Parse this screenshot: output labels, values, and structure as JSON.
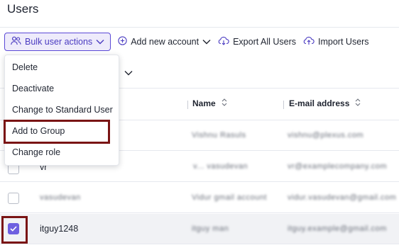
{
  "header": {
    "title": "Users"
  },
  "toolbar": {
    "bulk_label": "Bulk user actions",
    "add_label": "Add new account",
    "export_label": "Export All Users",
    "import_label": "Import Users"
  },
  "bulk_menu": {
    "items": [
      "Delete",
      "Deactivate",
      "Change to Standard User",
      "Add to Group",
      "Change role"
    ]
  },
  "table": {
    "columns": [
      "Name",
      "E-mail address"
    ],
    "rows": [
      {
        "username": "",
        "name": "Vishnu Rasuls",
        "email": "vishnu@plexus.com",
        "checked": false
      },
      {
        "username": "vr",
        "name": "v... vasudevan",
        "email": "vr@examplecompany.com",
        "checked": false
      },
      {
        "username": "vasudevan",
        "name": "Vidur gmail account",
        "email": "vidur.vasudevan@gmail.com",
        "checked": false
      },
      {
        "username": "itguy1248",
        "name": "itguy man",
        "email": "itguy.example@gmail.com",
        "checked": true
      }
    ]
  },
  "colors": {
    "accent": "#5b49d6",
    "highlight": "#7a1414"
  }
}
